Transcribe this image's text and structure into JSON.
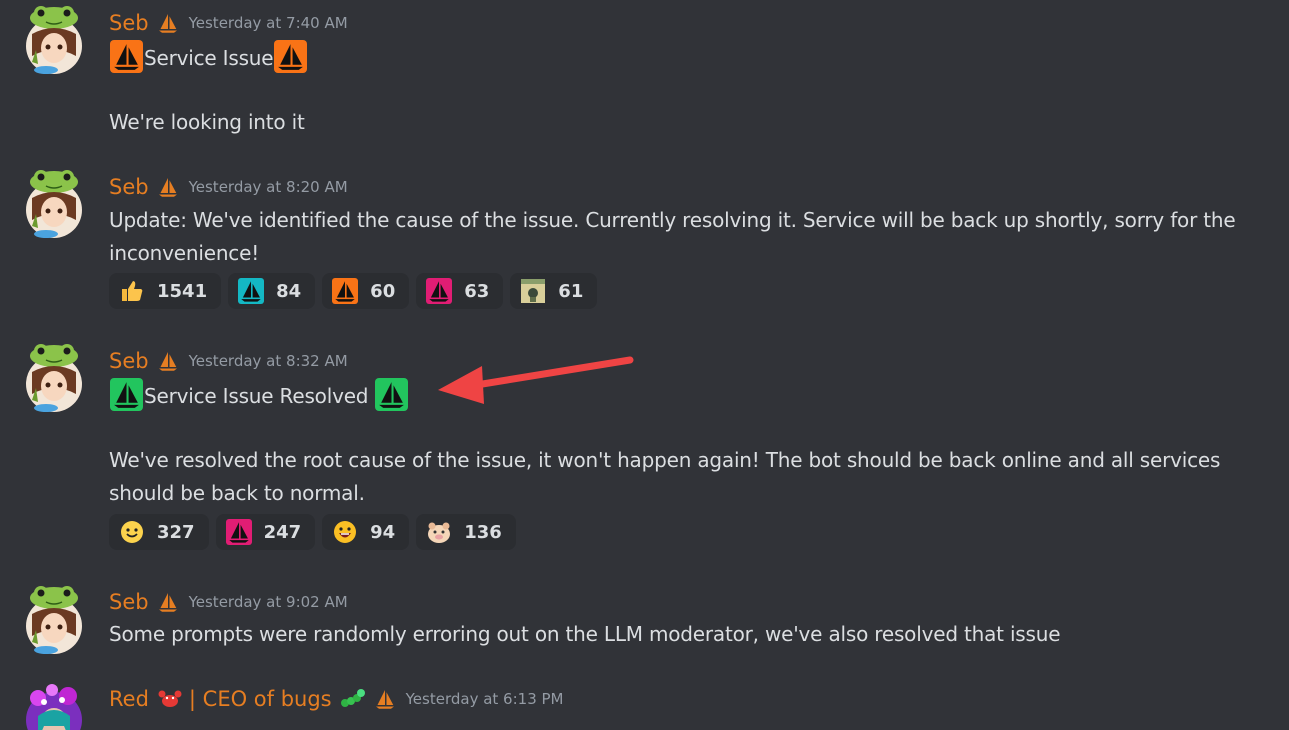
{
  "colors": {
    "background": "#313338",
    "username": "#e67e22",
    "timestamp": "#949ba4",
    "text": "#dbdee1",
    "reaction_bg": "#2b2d31",
    "arrow": "#ef4444"
  },
  "messages": [
    {
      "username": "Seb",
      "timestamp": "Yesterday at 7:40 AM",
      "title": "Service Issue",
      "body": "We're looking into it"
    },
    {
      "username": "Seb",
      "timestamp": "Yesterday at 8:20 AM",
      "body": "Update: We've identified the cause of the issue. Currently resolving it. Service will be back up shortly, sorry for the inconvenience!",
      "reactions": [
        {
          "icon": "thumbs-up-icon",
          "count": "1541"
        },
        {
          "icon": "teal-sailboat-icon",
          "count": "84"
        },
        {
          "icon": "orange-sailboat-icon",
          "count": "60"
        },
        {
          "icon": "pink-sailboat-icon",
          "count": "63"
        },
        {
          "icon": "sticker-emoji-icon",
          "count": "61"
        }
      ]
    },
    {
      "username": "Seb",
      "timestamp": "Yesterday at 8:32 AM",
      "title": "Service Issue Resolved",
      "body": "We've resolved the root cause of the issue, it won't happen again! The bot should be back online and all services should be back to normal.",
      "reactions": [
        {
          "icon": "smile-icon",
          "count": "327"
        },
        {
          "icon": "pink-sailboat-icon",
          "count": "247"
        },
        {
          "icon": "grin-icon",
          "count": "94"
        },
        {
          "icon": "pig-icon",
          "count": "136"
        }
      ]
    },
    {
      "username": "Seb",
      "timestamp": "Yesterday at 9:02 AM",
      "body": "Some prompts were randomly erroring out on the LLM moderator, we've also resolved that issue"
    },
    {
      "username": "Red",
      "username_suffix": " | CEO of bugs",
      "timestamp": "Yesterday at 6:13 PM"
    }
  ]
}
